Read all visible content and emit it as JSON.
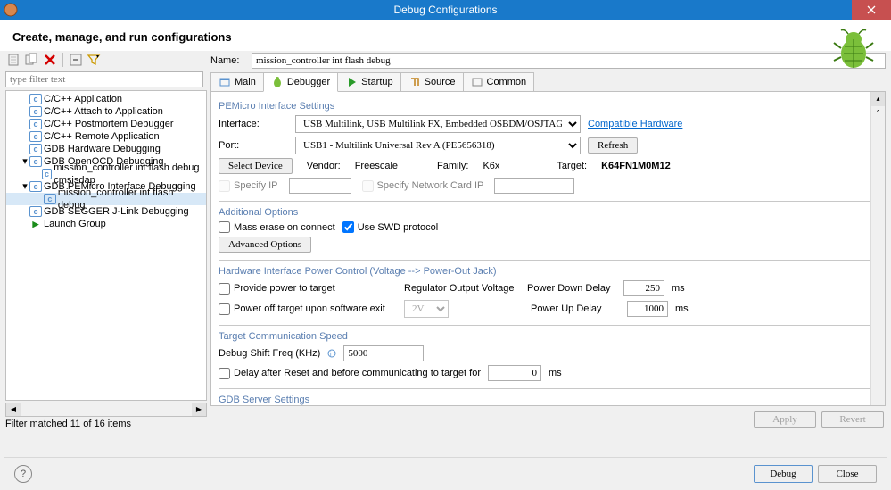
{
  "window": {
    "title": "Debug Configurations"
  },
  "header": {
    "title": "Create, manage, and run configurations"
  },
  "filter": {
    "placeholder": "type filter text"
  },
  "tree": {
    "items": [
      {
        "label": "C/C++ Application",
        "level": 1
      },
      {
        "label": "C/C++ Attach to Application",
        "level": 1
      },
      {
        "label": "C/C++ Postmortem Debugger",
        "level": 1
      },
      {
        "label": "C/C++ Remote Application",
        "level": 1
      },
      {
        "label": "GDB Hardware Debugging",
        "level": 1
      },
      {
        "label": "GDB OpenOCD Debugging",
        "level": 1,
        "expander": "▸",
        "expanded": true
      },
      {
        "label": "mission_controller int flash debug cmsisdap",
        "level": 2
      },
      {
        "label": "GDB PEMicro Interface Debugging",
        "level": 1,
        "expander": "▸",
        "expanded": true
      },
      {
        "label": "mission_controller int flash debug",
        "level": 2,
        "sel": true
      },
      {
        "label": "GDB SEGGER J-Link Debugging",
        "level": 1
      },
      {
        "label": "Launch Group",
        "level": 1,
        "run": true
      }
    ]
  },
  "status": "Filter matched 11 of 16 items",
  "name_label": "Name:",
  "name_value": "mission_controller int flash debug",
  "tabs": {
    "items": [
      {
        "label": "Main",
        "ico": "main"
      },
      {
        "label": "Debugger",
        "ico": "bug",
        "active": true
      },
      {
        "label": "Startup",
        "ico": "play"
      },
      {
        "label": "Source",
        "ico": "src"
      },
      {
        "label": "Common",
        "ico": "com"
      }
    ]
  },
  "form": {
    "group_interface": "PEMicro Interface Settings",
    "interface_label": "Interface:",
    "interface_value": "USB Multilink, USB Multilink FX, Embedded OSBDM/OSJTAG - USB Port",
    "compatible_link": "Compatible Hardware",
    "port_label": "Port:",
    "port_value": "USB1 - Multilink Universal Rev A (PE5656318)",
    "refresh": "Refresh",
    "select_device": "Select Device",
    "vendor_label": "Vendor:",
    "vendor_value": "Freescale",
    "family_label": "Family:",
    "family_value": "K6x",
    "target_label": "Target:",
    "target_value": "K64FN1M0M12",
    "specify_ip": "Specify IP",
    "specify_nic": "Specify Network Card IP",
    "group_additional": "Additional Options",
    "mass_erase": "Mass erase on connect",
    "use_swd": "Use SWD protocol",
    "advanced": "Advanced Options",
    "group_power": "Hardware Interface Power Control (Voltage --> Power-Out Jack)",
    "provide_power": "Provide power to target",
    "regulator": "Regulator Output Voltage",
    "power_down": "Power Down Delay",
    "power_down_val": "250",
    "power_up": "Power Up Delay",
    "power_up_val": "1000",
    "ms": "ms",
    "power_off": "Power off target upon software exit",
    "v2": "2V",
    "group_speed": "Target Communication Speed",
    "shift_freq": "Debug Shift Freq (KHz)",
    "shift_freq_val": "5000",
    "delay_reset": "Delay after Reset and before communicating to target for",
    "delay_reset_val": "0",
    "group_gdb": "GDB Server Settings"
  },
  "buttons": {
    "apply": "Apply",
    "revert": "Revert",
    "debug": "Debug",
    "close": "Close"
  }
}
